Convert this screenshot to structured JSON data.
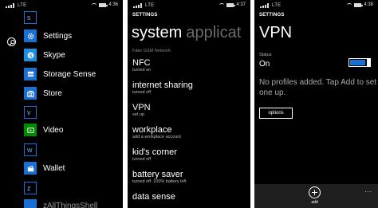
{
  "screens": [
    {
      "status": {
        "network": "LTE",
        "time": "4:36"
      },
      "app_list": {
        "tiles": [
          {
            "letter": "s"
          },
          {
            "letter": "v"
          },
          {
            "letter": "w"
          },
          {
            "letter": "z"
          }
        ],
        "apps": [
          {
            "label": "Settings",
            "icon": "gear-icon"
          },
          {
            "label": "Skype",
            "icon": "skype-icon"
          },
          {
            "label": "Storage Sense",
            "icon": "storage-icon"
          },
          {
            "label": "Store",
            "icon": "store-icon"
          },
          {
            "label": "Video",
            "icon": "video-icon"
          },
          {
            "label": "Wallet",
            "icon": "wallet-icon"
          },
          {
            "label": "zAllThingsShell",
            "icon": "app-icon"
          }
        ]
      }
    },
    {
      "status": {
        "network": "LTE",
        "time": "4:37"
      },
      "header": "SETTINGS",
      "pivot": {
        "active": "system",
        "next": "applicat"
      },
      "faded_text": "Fake GSM Network",
      "items": [
        {
          "title": "NFC",
          "subtitle": "turned on"
        },
        {
          "title": "internet sharing",
          "subtitle": "turned off"
        },
        {
          "title": "VPN",
          "subtitle": "set up"
        },
        {
          "title": "workplace",
          "subtitle": "add a workplace account"
        },
        {
          "title": "kid's corner",
          "subtitle": "turned off"
        },
        {
          "title": "battery saver",
          "subtitle": "turned off. 100% battery left"
        },
        {
          "title": "data sense",
          "subtitle": ""
        }
      ]
    },
    {
      "status": {
        "network": "LTE",
        "time": "4:38"
      },
      "header": "SETTINGS",
      "title": "VPN",
      "status_label": "Status",
      "status_value": "On",
      "toggle_on": true,
      "message": "No profiles added. Tap Add to set one up.",
      "options_label": "options",
      "appbar": {
        "add_label": "add",
        "more": "..."
      }
    }
  ]
}
